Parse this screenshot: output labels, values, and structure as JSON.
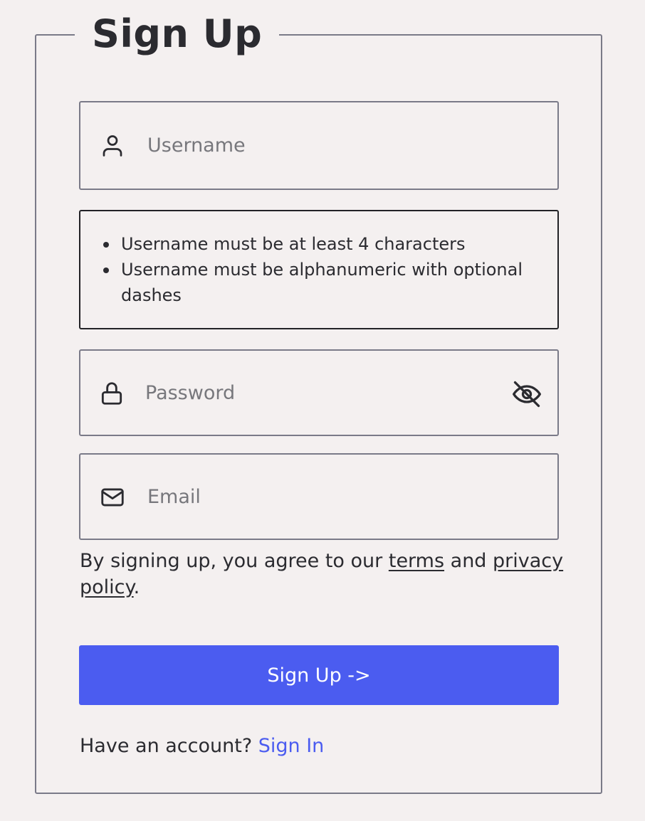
{
  "form": {
    "title": "Sign Up",
    "username": {
      "placeholder": "Username",
      "value": "",
      "icon": "user-icon"
    },
    "username_rules": [
      "Username must be at least 4 characters",
      "Username must be alphanumeric with optional dashes"
    ],
    "password": {
      "placeholder": "Password",
      "value": "",
      "icon": "lock-icon",
      "toggle_icon": "eye-off-icon"
    },
    "email": {
      "placeholder": "Email",
      "value": "",
      "icon": "mail-icon"
    },
    "agreement": {
      "prefix": "By signing up, you agree to our ",
      "terms_link": "terms",
      "middle": " and ",
      "privacy_link": "privacy policy",
      "suffix": "."
    },
    "submit_label": "Sign Up ->",
    "signin_prompt": "Have an account? ",
    "signin_link": "Sign In"
  },
  "colors": {
    "background": "#f4f0f0",
    "accent": "#4b5cf0",
    "text": "#2b2b30",
    "border": "#7a7a88"
  }
}
